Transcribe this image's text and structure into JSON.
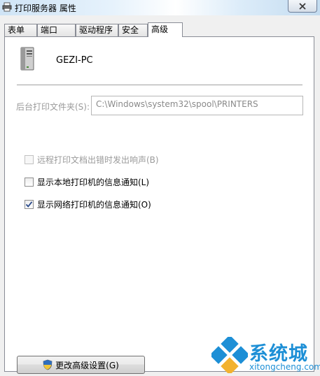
{
  "window": {
    "title": "打印服务器 属性",
    "close_label": "X"
  },
  "tabs": [
    {
      "label": "表单",
      "active": false
    },
    {
      "label": "端口",
      "active": false
    },
    {
      "label": "驱动程序",
      "active": false
    },
    {
      "label": "安全",
      "active": false
    },
    {
      "label": "高级",
      "active": true
    }
  ],
  "server": {
    "name": "GEZI-PC",
    "icon": "server-tower-icon"
  },
  "spool_folder": {
    "label": "后台打印文件夹(S):",
    "value": "C:\\Windows\\system32\\spool\\PRINTERS"
  },
  "options": [
    {
      "label": "远程打印文档出错时发出响声(B)",
      "checked": false,
      "enabled": false
    },
    {
      "label": "显示本地打印机的信息通知(L)",
      "checked": false,
      "enabled": true
    },
    {
      "label": "显示网络打印机的信息通知(O)",
      "checked": true,
      "enabled": true
    }
  ],
  "action_button": {
    "label": "更改高级设置(G)",
    "icon": "uac-shield-icon"
  },
  "watermark": {
    "brand": "系统城",
    "url": "xitongcheng.com"
  },
  "colors": {
    "brand": "#1d8fd6",
    "check_mark": "#2a4a8a",
    "disabled_text": "#9a9a9a"
  }
}
